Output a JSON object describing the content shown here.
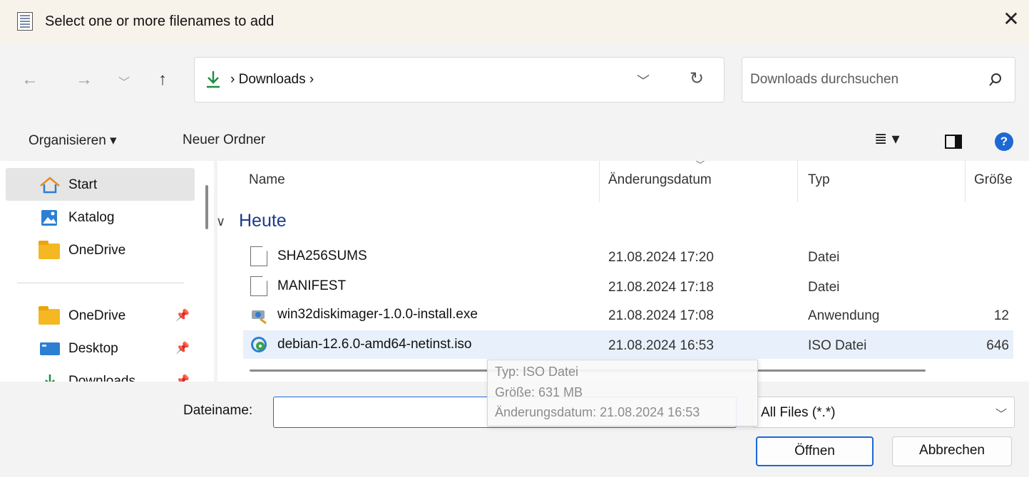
{
  "window": {
    "title": "Select one or more  filenames to add",
    "close_icon": "close-icon"
  },
  "nav": {
    "back": "←",
    "forward": "→",
    "recent": "﹀",
    "up": "↑",
    "address": {
      "segments": [
        "Downloads"
      ],
      "text": "›  Downloads  ›"
    },
    "search_placeholder": "Downloads durchsuchen"
  },
  "toolbar": {
    "organize": "Organisieren ▾",
    "new_folder": "Neuer Ordner",
    "view_icon": "view-menu-icon",
    "help": "?"
  },
  "sidebar": {
    "items": [
      {
        "label": "Start",
        "icon": "home-icon",
        "selected": true
      },
      {
        "label": "Katalog",
        "icon": "gallery-icon"
      },
      {
        "label": "OneDrive",
        "icon": "folder-icon"
      },
      {
        "label": "OneDrive",
        "icon": "folder-icon",
        "pinned": true
      },
      {
        "label": "Desktop",
        "icon": "desktop-icon",
        "pinned": true
      },
      {
        "label": "Downloads",
        "icon": "download-icon",
        "pinned": true
      }
    ]
  },
  "filelist": {
    "columns": [
      "Name",
      "Änderungsdatum",
      "Typ",
      "Größe"
    ],
    "group": "Heute",
    "rows": [
      {
        "name": "SHA256SUMS",
        "date": "21.08.2024 17:20",
        "type": "Datei",
        "size": "",
        "icon": "document-icon"
      },
      {
        "name": "MANIFEST",
        "date": "21.08.2024 17:18",
        "type": "Datei",
        "size": "",
        "icon": "document-icon"
      },
      {
        "name": "win32diskimager-1.0.0-install.exe",
        "date": "21.08.2024 17:08",
        "type": "Anwendung",
        "size": "12",
        "icon": "installer-icon"
      },
      {
        "name": "debian-12.6.0-amd64-netinst.iso",
        "date": "21.08.2024 16:53",
        "type": "ISO Datei",
        "size": "646",
        "icon": "disc-image-icon",
        "selected": true
      }
    ]
  },
  "tooltip": {
    "type": "Typ: ISO Datei",
    "size": "Größe: 631 MB",
    "date": "Änderungsdatum: 21.08.2024 16:53"
  },
  "bottom": {
    "filename_label": "Dateiname:",
    "filename_value": "",
    "filter": "All Files (*.*)",
    "open": "Öffnen",
    "cancel": "Abbrechen"
  },
  "colors": {
    "accent": "#1c68d4",
    "group_header": "#1e3c8c",
    "folder": "#f5b722",
    "download_green": "#1a8f3a"
  }
}
